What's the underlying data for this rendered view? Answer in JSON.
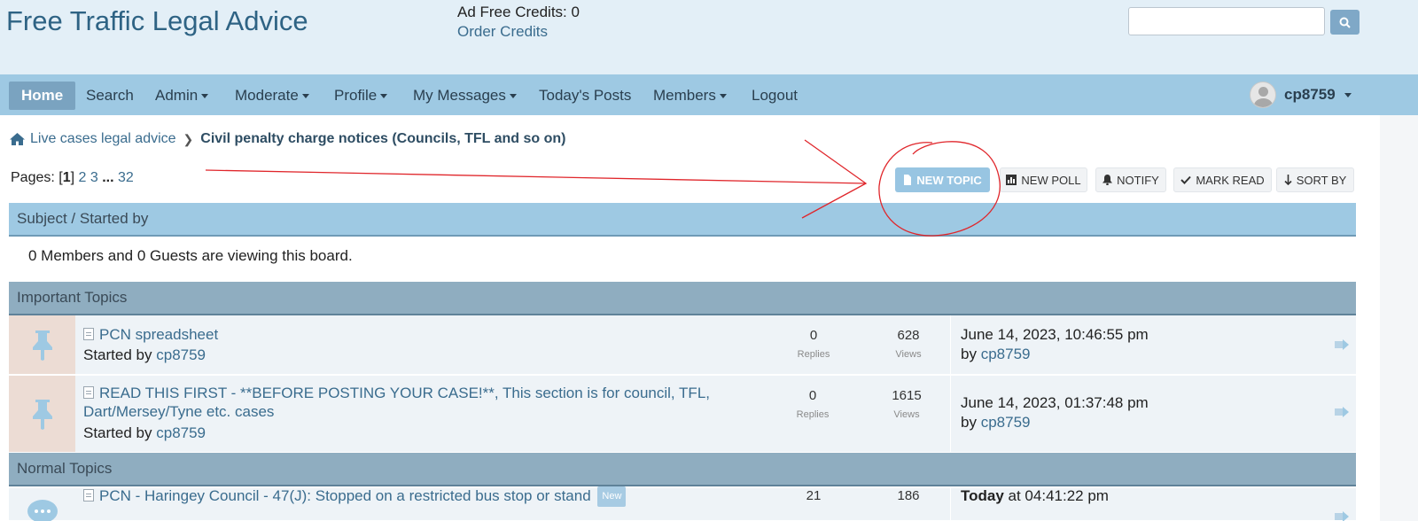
{
  "header": {
    "site_title": "Free Traffic Legal Advice",
    "ad_credits": "Ad Free Credits: 0",
    "order_credits": "Order Credits",
    "search_placeholder": ""
  },
  "nav": {
    "items": [
      {
        "label": "Home",
        "active": true
      },
      {
        "label": "Search"
      },
      {
        "label": "Admin",
        "dropdown": true
      },
      {
        "label": "Moderate",
        "dropdown": true
      },
      {
        "label": "Profile",
        "dropdown": true
      },
      {
        "label": "My Messages",
        "dropdown": true
      },
      {
        "label": "Today's Posts"
      },
      {
        "label": "Members",
        "dropdown": true
      },
      {
        "label": "Logout"
      }
    ],
    "username": "cp8759"
  },
  "breadcrumb": {
    "parent": "Live cases legal advice",
    "current": "Civil penalty charge notices (Councils, TFL and so on)"
  },
  "pages": {
    "label": "Pages:",
    "current": "1",
    "links": [
      "2",
      "3"
    ],
    "ellipsis": "...",
    "last": "32"
  },
  "buttons": {
    "new_topic": "NEW TOPIC",
    "new_poll": "NEW POLL",
    "notify": "NOTIFY",
    "mark_read": "MARK READ",
    "sort_by": "SORT BY"
  },
  "table": {
    "header": "Subject / Started by",
    "viewing": "0 Members and 0 Guests are viewing this board.",
    "important_header": "Important Topics",
    "normal_header": "Normal Topics"
  },
  "topics": [
    {
      "title": "PCN spreadsheet",
      "started_by_label": "Started by",
      "author": "cp8759",
      "replies": "0",
      "replies_label": "Replies",
      "views": "628",
      "views_label": "Views",
      "last_post": "June 14, 2023, 10:46:55 pm",
      "by_label": "by",
      "last_author": "cp8759"
    },
    {
      "title": "READ THIS FIRST - **BEFORE POSTING YOUR CASE!**, This section is for council, TFL, Dart/Mersey/Tyne etc. cases",
      "started_by_label": "Started by",
      "author": "cp8759",
      "replies": "0",
      "replies_label": "Replies",
      "views": "1615",
      "views_label": "Views",
      "last_post": "June 14, 2023, 01:37:48 pm",
      "by_label": "by",
      "last_author": "cp8759"
    },
    {
      "title": "PCN - Haringey Council - 47(J): Stopped on a restricted bus stop or stand",
      "badge": "New",
      "replies": "21",
      "views": "186",
      "last_post_bold": "Today",
      "last_post_rest": " at 04:41:22 pm"
    }
  ],
  "colors": {
    "header_bg": "#e3eff7",
    "nav_bg": "#9ec9e3",
    "accent": "#3a6c8e",
    "annotation": "#e0262b"
  }
}
